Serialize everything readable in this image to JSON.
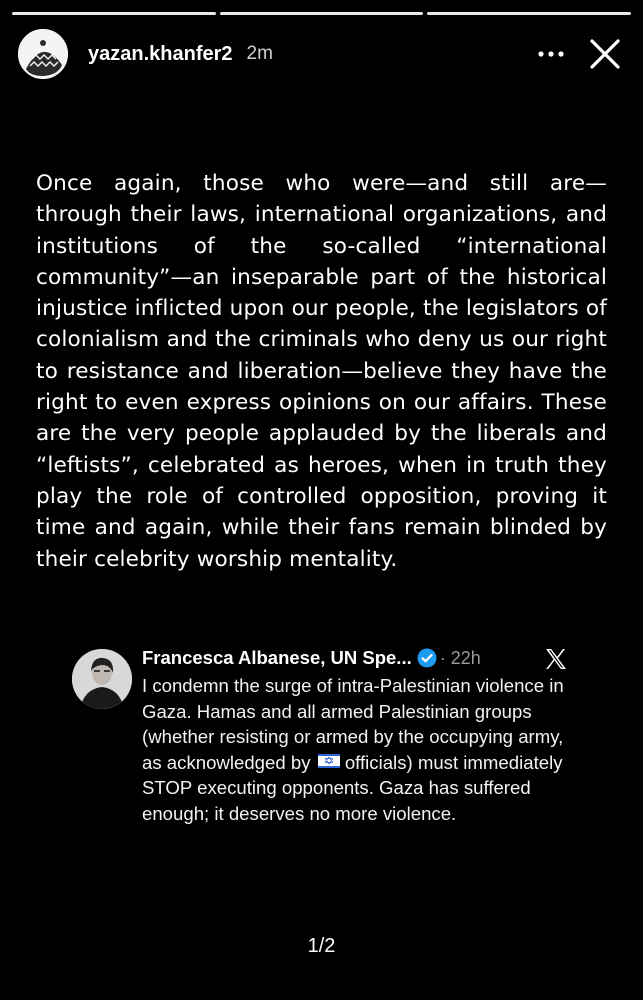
{
  "story": {
    "segments": [
      {
        "state": "done"
      },
      {
        "state": "done"
      },
      {
        "state": "done"
      }
    ],
    "username": "yazan.khanfer2",
    "time": "2m",
    "more_icon": "more-horizontal-icon",
    "close_icon": "close-icon",
    "text": "Once again, those who were—and still are— through their laws, international organizations, and institutions of the so-called “international community”—an inseparable part of the historical injustice inflicted upon our people, the legislators of colonialism and the criminals who deny us our right to resistance and liberation—believe they have the right to even express opinions on our affairs. These are the very people applauded by the liberals and “leftists”, celebrated as heroes, when in truth they play the role of controlled opposition, proving it time and again, while their fans remain blinded by their celebrity worship mentality.",
    "pager": "1/2"
  },
  "tweet": {
    "author": "Francesca Albanese, UN Spe...",
    "time": "· 22h",
    "body_before_flag": "I condemn the surge of intra-Palestinian violence in Gaza. Hamas and all armed Palestinian groups (whether resisting or armed by the occupying army, as acknowledged by ",
    "body_after_flag": " officials) must immediately STOP executing opponents. Gaza has suffered enough; it deserves no more violence.",
    "verified_color": "#1d9bf0",
    "platform_icon": "x-logo-icon"
  }
}
